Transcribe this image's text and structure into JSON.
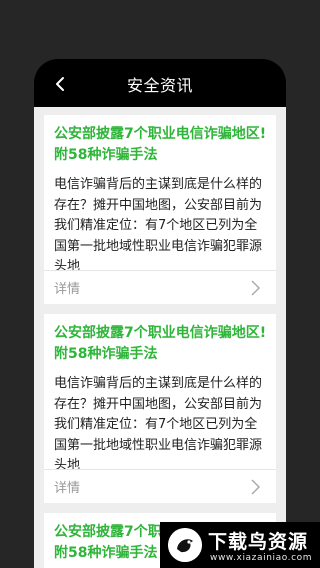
{
  "header": {
    "title": "安全资讯",
    "back_icon": "chevron-left-icon"
  },
  "articles": [
    {
      "headline": "公安部披露7个职业电信诈骗地区!附58种诈骗手法",
      "summary": "电信诈骗背后的主谋到底是什么样的存在？摊开中国地图，公安部目前为我们精准定位：有7个地区已列为全国第一批地域性职业电信诈骗犯罪源头地",
      "details_label": "详情"
    },
    {
      "headline": "公安部披露7个职业电信诈骗地区!附58种诈骗手法",
      "summary": "电信诈骗背后的主谋到底是什么样的存在？摊开中国地图，公安部目前为我们精准定位：有7个地区已列为全国第一批地域性职业电信诈骗犯罪源头地",
      "details_label": "详情"
    },
    {
      "headline": "公安部披露7个职业电信诈骗地区!附58种诈骗手法",
      "summary": "",
      "details_label": ""
    }
  ],
  "watermark": {
    "name": "下载鸟资源",
    "url": "www.xiazainiao.com"
  },
  "colors": {
    "accent": "#2fb53a",
    "background": "#262626",
    "card": "#ffffff",
    "list_bg": "#eeeeee"
  }
}
